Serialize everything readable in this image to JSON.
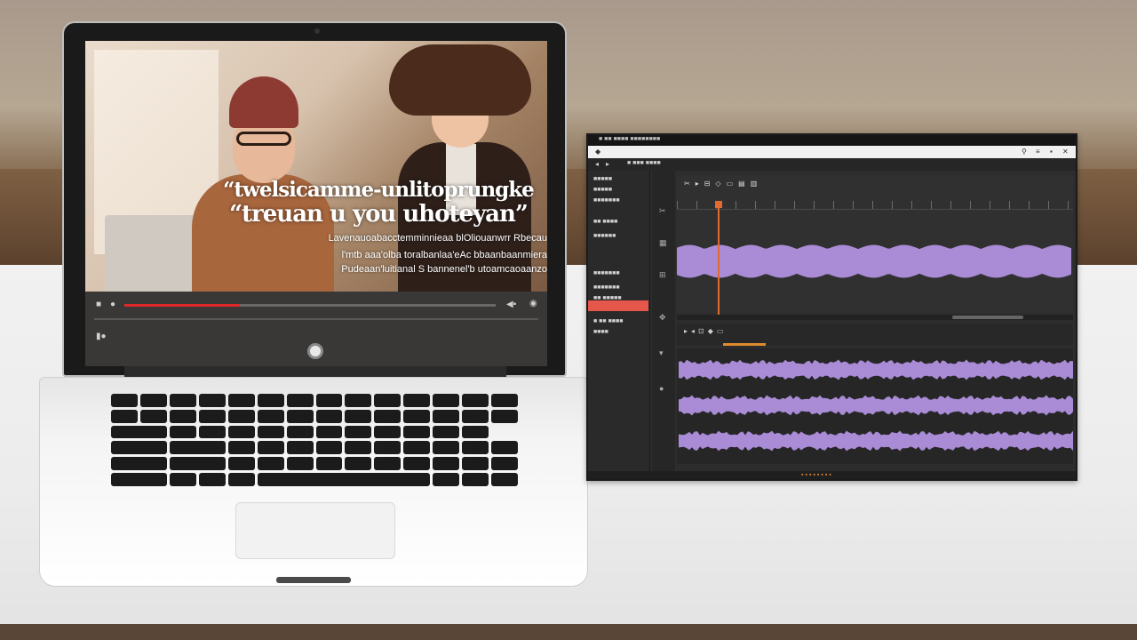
{
  "video_player": {
    "caption_line1": "“twelsicamme-unlitoprungke",
    "caption_line2": "“treuan u you  uhoteyan”",
    "subtitle_line1": "Lavenauoabacctemminnieaa blOliouanwrr Rbecau",
    "subtitle_line2": "l'mtb aaa'olba toralbanlaa'eAc bbaanbaanmiera",
    "subtitle_line3": "Pudeaan'luitianal S bannenel'b utoamcaoaanzo",
    "progress": 0.31,
    "accent_color": "#e0282a",
    "icons": [
      "play-icon",
      "volume-icon",
      "settings-icon",
      "fullscreen-icon",
      "play-pause-icon"
    ]
  },
  "audio_editor": {
    "menu_text": "■ ■■ ■■■■ ■■■■■■■■",
    "toolbar_text": "■ ■■■ ■■■■",
    "panel_items": [
      "■■■■■",
      "■■■■■",
      "■■■■■■■",
      "■■ ■■■■",
      "■■■■■■",
      "■■■■■■■",
      "■■■■■■■",
      "■■ ■■■■■",
      "■ ■■ ■■■■",
      "■■■■"
    ],
    "waveform_color": "#a98bd6",
    "highlight_color": "#e5574a",
    "playhead_color": "#e06a30",
    "tool_icons": [
      "scissors-icon",
      "select-icon",
      "zoom-icon",
      "hand-icon",
      "marker-icon"
    ]
  }
}
